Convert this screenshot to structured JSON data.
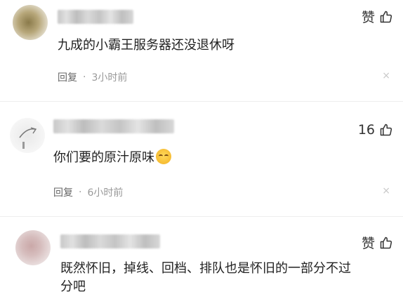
{
  "comments": [
    {
      "like_label": "赞",
      "text": "九成的小霸王服务器还没退休呀",
      "reply_label": "回复",
      "separator": "·",
      "time": "3小时前",
      "close_glyph": "×"
    },
    {
      "like_label": "16",
      "text": "你们要的原汁原味",
      "emoji": "smiling-face-emoji",
      "reply_label": "回复",
      "separator": "·",
      "time": "6小时前",
      "close_glyph": "×"
    },
    {
      "like_label": "赞",
      "text_line1": "既然怀旧，掉线、回档、排队也是怀旧的一部分不过",
      "text_line2": "分吧"
    }
  ],
  "icons": {
    "like": "thumbs-up-icon",
    "close": "close-icon"
  }
}
